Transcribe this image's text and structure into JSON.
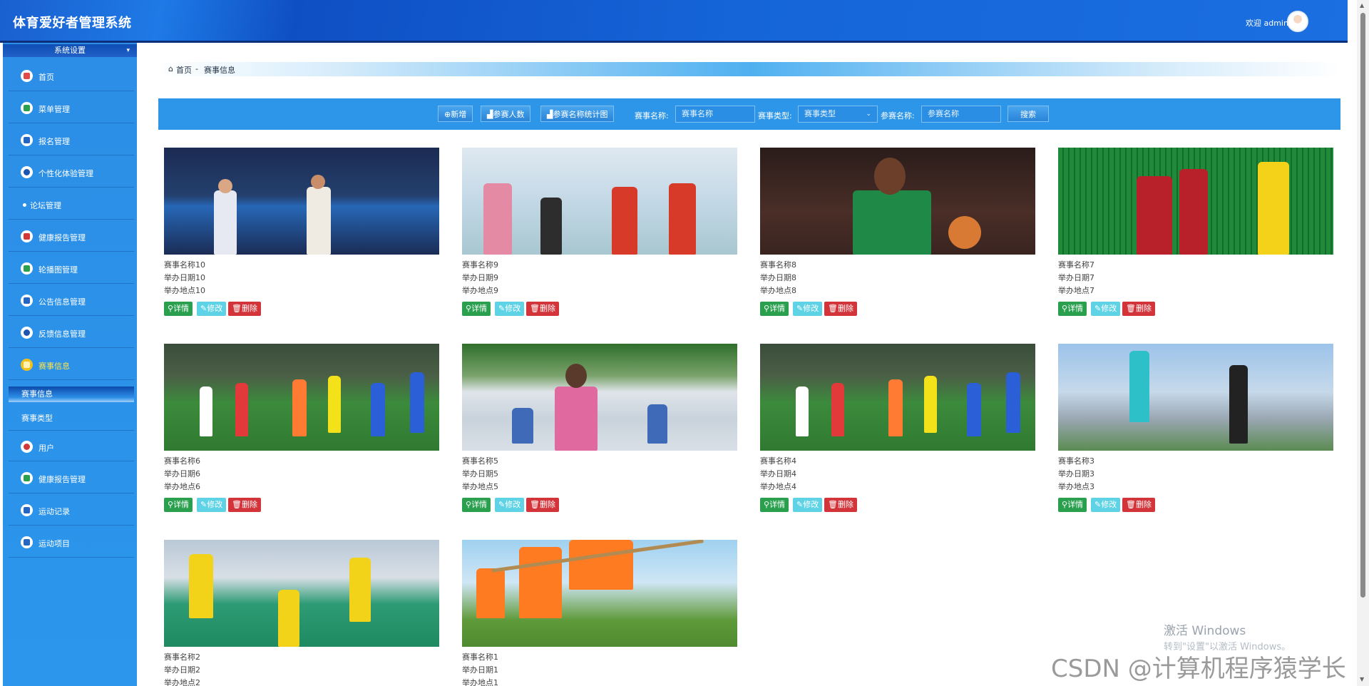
{
  "header": {
    "title": "体育爱好者管理系统",
    "welcome": "欢迎 admin"
  },
  "sidebar": {
    "section": "系统设置",
    "items": [
      {
        "label": "首页"
      },
      {
        "label": "菜单管理"
      },
      {
        "label": "报名管理"
      },
      {
        "label": "个性化体验管理"
      },
      {
        "label": "论坛管理"
      },
      {
        "label": "健康报告管理"
      },
      {
        "label": "轮播图管理"
      },
      {
        "label": "公告信息管理"
      },
      {
        "label": "反馈信息管理"
      },
      {
        "label": "赛事信息"
      },
      {
        "label": "用户"
      },
      {
        "label": "健康报告管理"
      },
      {
        "label": "运动记录"
      },
      {
        "label": "运动项目"
      }
    ],
    "subitems": [
      {
        "label": "赛事信息"
      },
      {
        "label": "赛事类型"
      }
    ]
  },
  "breadcrumb": {
    "home": "首页",
    "sep": "-",
    "current": "赛事信息"
  },
  "toolbar": {
    "add": "新增",
    "participants": "参赛人数",
    "stats": "参赛名称统计图",
    "name_label": "赛事名称:",
    "name_placeholder": "赛事名称",
    "type_label": "赛事类型:",
    "type_value": "赛事类型",
    "entry_label": "参赛名称:",
    "entry_placeholder": "参赛名称",
    "search": "搜索"
  },
  "card_actions": {
    "detail": "详情",
    "edit": "修改",
    "delete": "删除"
  },
  "events": [
    {
      "name": "赛事名称10",
      "date": "举办日期10",
      "place": "举办地点10"
    },
    {
      "name": "赛事名称9",
      "date": "举办日期9",
      "place": "举办地点9"
    },
    {
      "name": "赛事名称8",
      "date": "举办日期8",
      "place": "举办地点8"
    },
    {
      "name": "赛事名称7",
      "date": "举办日期7",
      "place": "举办地点7"
    },
    {
      "name": "赛事名称6",
      "date": "举办日期6",
      "place": "举办地点6"
    },
    {
      "name": "赛事名称5",
      "date": "举办日期5",
      "place": "举办地点5"
    },
    {
      "name": "赛事名称4",
      "date": "举办日期4",
      "place": "举办地点4"
    },
    {
      "name": "赛事名称3",
      "date": "举办日期3",
      "place": "举办地点3"
    },
    {
      "name": "赛事名称2",
      "date": "举办日期2",
      "place": "举办地点2"
    },
    {
      "name": "赛事名称1",
      "date": "举办日期1",
      "place": "举办地点1"
    }
  ],
  "overlay": {
    "windows_activate": "激活 Windows",
    "windows_hint": "转到\"设置\"以激活 Windows。",
    "csdn": "CSDN @计算机程序猿学长"
  }
}
